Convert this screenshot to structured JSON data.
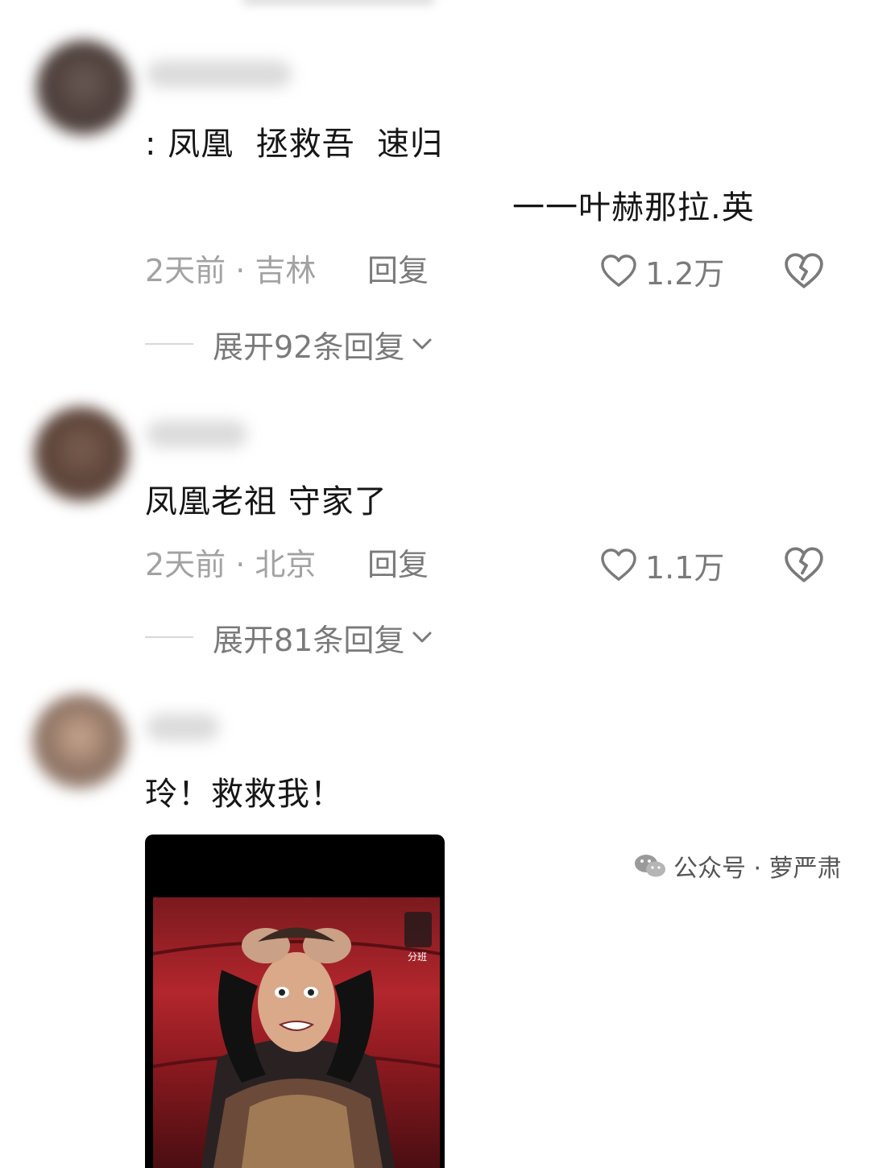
{
  "comments": [
    {
      "text_line1": ": 凤凰  拯救吾  速归",
      "text_line2": "一一叶赫那拉.英",
      "time_location": "2天前 · 吉林",
      "reply_label": "回复",
      "likes": "1.2万",
      "expand_label": "展开92条回复"
    },
    {
      "text_line1": "凤凰老祖 守家了",
      "time_location": "2天前 · 北京",
      "reply_label": "回复",
      "likes": "1.1万",
      "expand_label": "展开81条回复"
    },
    {
      "text_line1": "玲！救救我！",
      "media": {
        "overlay_text": "分班"
      }
    }
  ],
  "watermark": {
    "text": "公众号 · 萝严肃",
    "icon": "wechat-icon"
  },
  "colors": {
    "meta_gray": "#a2a2a2",
    "action_gray": "#7a7a7a",
    "text": "#161616"
  }
}
